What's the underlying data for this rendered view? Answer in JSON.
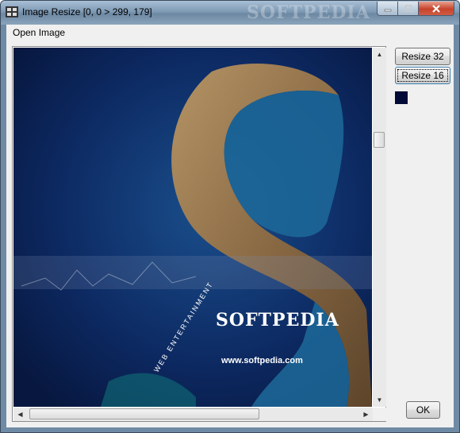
{
  "window": {
    "title": "Image Resize [0, 0 > 299, 179]",
    "watermark": "SOFTPEDIA",
    "controls": {
      "minimize_icon": "minimize-icon",
      "maximize_icon": "maximize-icon",
      "close_icon": "close-icon"
    }
  },
  "menu": {
    "open_image": "Open Image"
  },
  "image": {
    "brand_text": "SOFTPEDIA",
    "url_text": "www.softpedia.com",
    "curved_text": "WEB ENTERTAINMENT",
    "colors": {
      "ocean": "#0b1f4d",
      "land": "#8a6a44",
      "lagoon": "#1d6a9a"
    }
  },
  "buttons": {
    "resize32": "Resize 32",
    "resize16": "Resize 16",
    "ok": "OK"
  },
  "swatch": {
    "color": "#020a38"
  }
}
